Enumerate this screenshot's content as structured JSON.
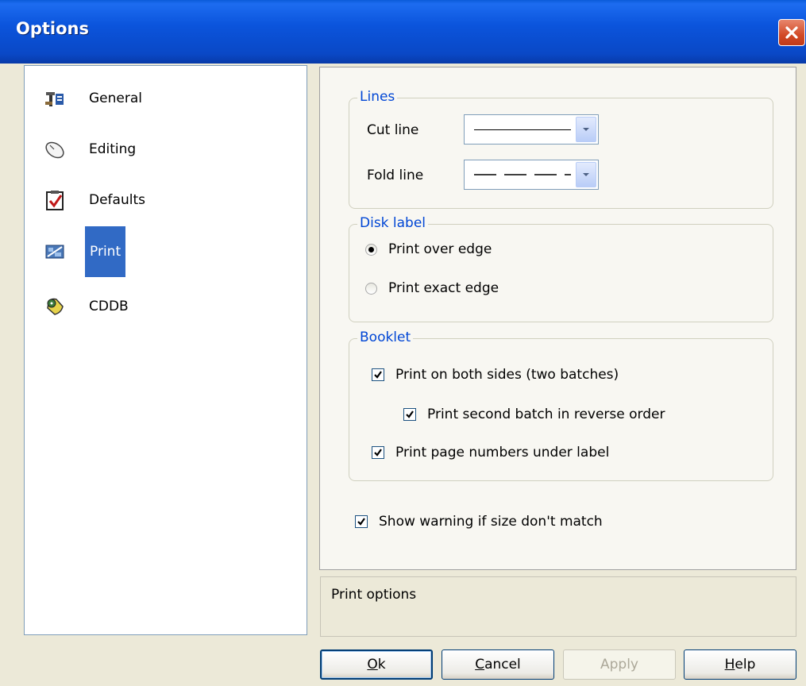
{
  "window": {
    "title": "Options"
  },
  "nav": {
    "items": [
      {
        "label": "General",
        "icon": "tools-icon"
      },
      {
        "label": "Editing",
        "icon": "mouse-icon"
      },
      {
        "label": "Defaults",
        "icon": "checklist-icon"
      },
      {
        "label": "Print",
        "icon": "print-icon"
      },
      {
        "label": "CDDB",
        "icon": "cd-icon"
      }
    ],
    "selected": "Print"
  },
  "lines": {
    "legend": "Lines",
    "cut_label": "Cut line",
    "cut_value": "solid",
    "fold_label": "Fold line",
    "fold_value": "dashed"
  },
  "disk_label": {
    "legend": "Disk label",
    "options": [
      "Print over edge",
      "Print exact edge"
    ],
    "selected": "Print over edge"
  },
  "booklet": {
    "legend": "Booklet",
    "both_sides": "Print on both sides (two batches)",
    "reverse_order": "Print second batch in reverse order",
    "page_numbers": "Print page numbers under label"
  },
  "warning": "Show warning if size don't match",
  "status_text": "Print options",
  "buttons": {
    "ok": {
      "pre": "",
      "key": "O",
      "post": "k"
    },
    "cancel": {
      "pre": "",
      "key": "C",
      "post": "ancel"
    },
    "apply": "Apply",
    "help": {
      "pre": "",
      "key": "H",
      "post": "elp"
    }
  },
  "colors": {
    "selection": "#316ac5",
    "titlebar": "#0a54dc",
    "legend": "#0046d5"
  }
}
